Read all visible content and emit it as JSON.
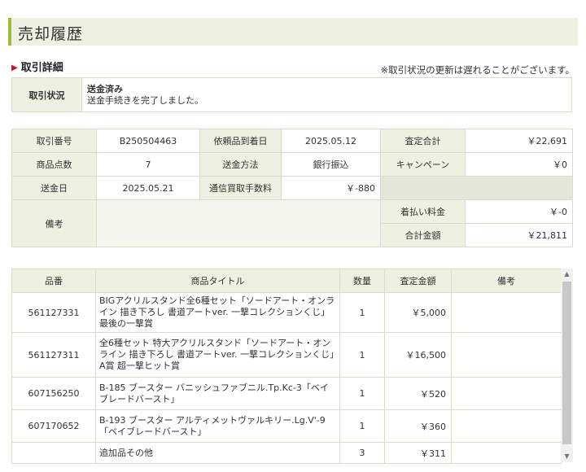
{
  "header": {
    "title": "売却履歴"
  },
  "section": {
    "title": "取引詳細",
    "notice": "※取引状況の更新は遅れることがございます。"
  },
  "status": {
    "label": "取引状況",
    "value": "送金済み",
    "message": "送金手続きを完了しました。"
  },
  "details": {
    "trade_no_label": "取引番号",
    "trade_no": "B250504463",
    "arrival_label": "依頼品到着日",
    "arrival": "2025.05.12",
    "appraisal_total_label": "査定合計",
    "appraisal_total": "￥22,691",
    "item_count_label": "商品点数",
    "item_count": "7",
    "remit_method_label": "送金方法",
    "remit_method": "銀行振込",
    "campaign_label": "キャンペーン",
    "campaign": "￥0",
    "remit_date_label": "送金日",
    "remit_date": "2025.05.21",
    "fee_label": "通信買取手数料",
    "fee": "￥-880",
    "remarks_label": "備考",
    "cod_label": "着払い料金",
    "cod": "￥-0",
    "total_label": "合計金額",
    "total": "￥21,811"
  },
  "items": {
    "headers": [
      "品番",
      "商品タイトル",
      "数量",
      "査定金額",
      "備考"
    ],
    "rows": [
      {
        "code": "561127331",
        "title": "BIGアクリルスタンド全6種セット「ソードアート・オンライン 描き下ろし 書道アートver. 一撃コレクションくじ」最後の一撃賞",
        "qty": "1",
        "amount": "￥5,000",
        "note": ""
      },
      {
        "code": "561127311",
        "title": "全6種セット 特大アクリルスタンド「ソードアート・オンライン 描き下ろし 書道アートver. 一撃コレクションくじ」A賞 超一撃ヒット賞",
        "qty": "1",
        "amount": "￥16,500",
        "note": ""
      },
      {
        "code": "607156250",
        "title": "B-185 ブースター バニッシュファブニル.Tp.Kc-3「ベイブレードバースト」",
        "qty": "1",
        "amount": "￥520",
        "note": ""
      },
      {
        "code": "607170652",
        "title": "B-193 ブースター アルティメットヴァルキリー.Lg.V'-9「ベイブレードバースト」",
        "qty": "1",
        "amount": "￥360",
        "note": ""
      },
      {
        "code": "",
        "title": "追加品その他",
        "qty": "3",
        "amount": "￥311",
        "note": ""
      }
    ]
  },
  "colors": {
    "accent": "#9cbc3c",
    "marker": "#c0102a",
    "label_bg": "#eef0e2"
  }
}
